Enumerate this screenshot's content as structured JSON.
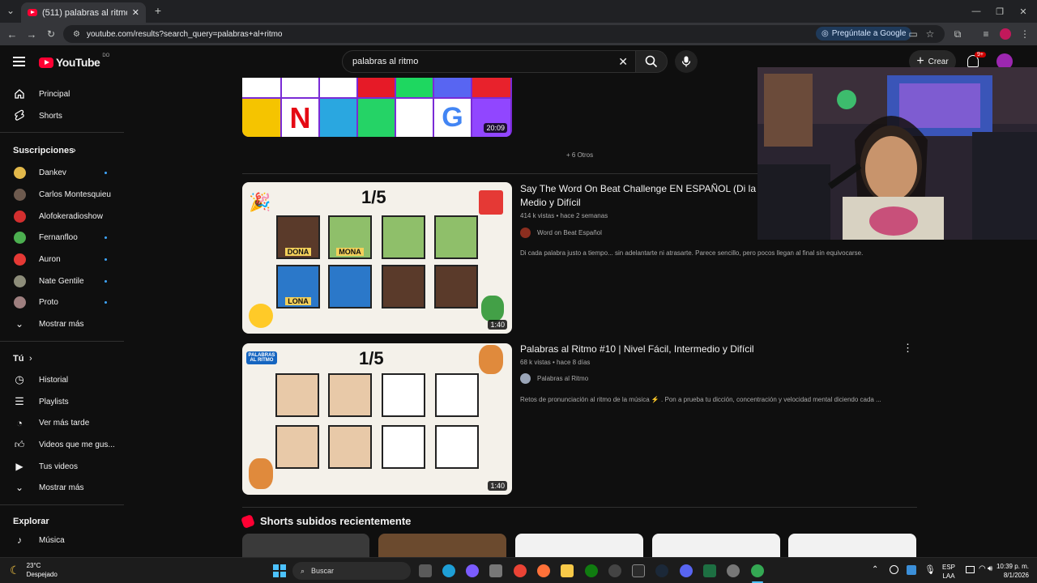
{
  "browser": {
    "tab_title": "(511) palabras al ritmo - YouTube",
    "url": "youtube.com/results?search_query=palabras+al+ritmo",
    "ask_google": "Pregúntale a Google"
  },
  "youtube": {
    "logo": "YouTube",
    "region": "DO",
    "search_value": "palabras al ritmo",
    "create_label": "Crear",
    "notifications": "9+"
  },
  "sidebar": {
    "home": "Principal",
    "shorts": "Shorts",
    "subscriptions": "Suscripciones",
    "channels": [
      "Dankev",
      "Carlos Montesquieu",
      "Alofokeradioshow",
      "Fernanfloo",
      "Auron",
      "Nate Gentile",
      "Proto"
    ],
    "show_more_1": "Mostrar más",
    "you": "Tú",
    "history": "Historial",
    "playlists": "Playlists",
    "watch_later": "Ver más tarde",
    "liked": "Videos que me gus...",
    "your_videos": "Tus videos",
    "show_more_2": "Mostrar más",
    "explore": "Explorar",
    "music": "Música"
  },
  "results": {
    "top_duration": "20:09",
    "more_others": "+ 6 Otros",
    "video1": {
      "thumb_title": "1/5",
      "labels": [
        "DONA",
        "MONA",
        "LONA"
      ],
      "title_line1": "Say The Word On Beat Challenge EN ESPAÑOL (Di la pa",
      "title_line2": "Medio y Difícil",
      "meta": "414 k vistas • hace 2 semanas",
      "channel": "Word on Beat Español",
      "desc": "Di cada palabra justo a tiempo... sin adelantarte ni atrasarte. Parece sencillo, pero pocos llegan al final sin equivocarse.",
      "duration": "1:40"
    },
    "video2": {
      "thumb_title": "1/5",
      "thumb_logo": "PALABRAS AL RITMO",
      "title": "Palabras al Ritmo #10 | Nivel Fácil, Intermedio y Difícil",
      "meta": "68 k vistas • hace 8 días",
      "channel": "Palabras al Ritmo",
      "desc": "Retos de pronunciación al ritmo de la música ⚡ . Pon a prueba tu dicción, concentración y velocidad mental diciendo cada ...",
      "duration": "1:40"
    },
    "shorts_heading": "Shorts subidos recientemente"
  },
  "taskbar": {
    "weather_temp": "23°C",
    "weather_desc": "Despejado",
    "search": "Buscar",
    "lang1": "ESP",
    "lang2": "LAA",
    "time": "10:39 p. m.",
    "date": "8/1/2026"
  }
}
